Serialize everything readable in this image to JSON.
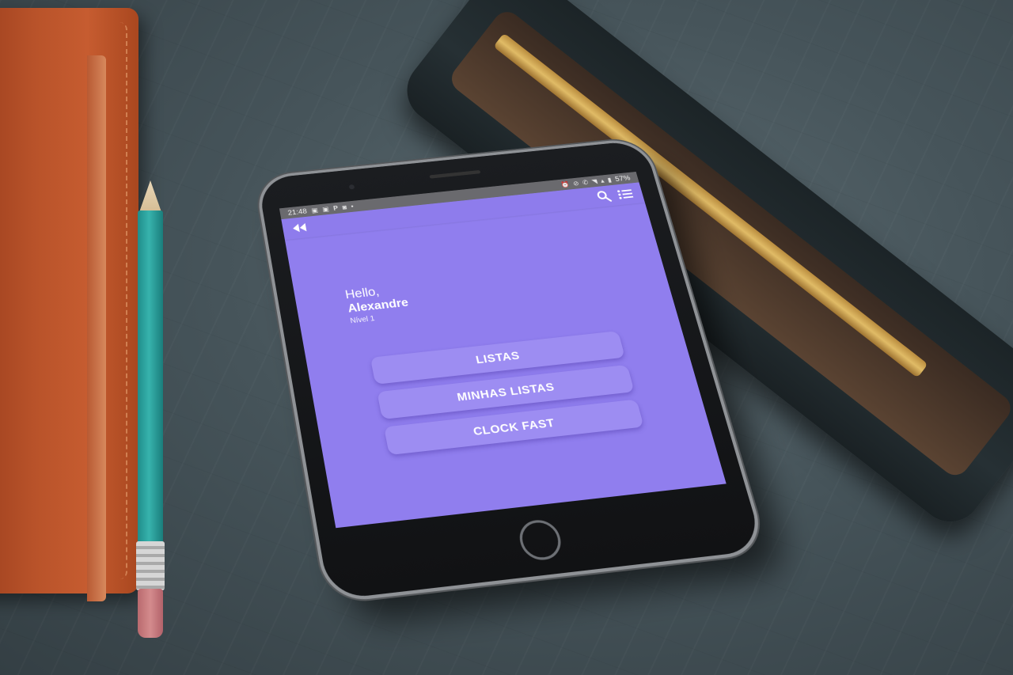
{
  "status_bar": {
    "time": "21:48",
    "battery": "57%",
    "left_icons": [
      "gallery-icon",
      "gallery-icon",
      "parking-icon",
      "data-saver-icon",
      "dot-icon"
    ],
    "right_icons": [
      "alarm-icon",
      "mute-icon",
      "volte-icon",
      "wifi-icon",
      "signal-icon",
      "battery-icon"
    ]
  },
  "app_bar": {
    "back_icon": "rewind-icon",
    "search_icon": "search-icon",
    "list_icon": "list-icon"
  },
  "greeting": {
    "hello": "Hello,",
    "name": "Alexandre",
    "level": "Nível 1"
  },
  "menu": {
    "listas": "LISTAS",
    "minhas_listas": "MINHAS LISTAS",
    "clock_fast": "CLOCK FAST"
  },
  "colors": {
    "screen_bg": "#907eee",
    "button_bg": "#9d8df2",
    "status_bar_bg": "#6a6a6e"
  }
}
